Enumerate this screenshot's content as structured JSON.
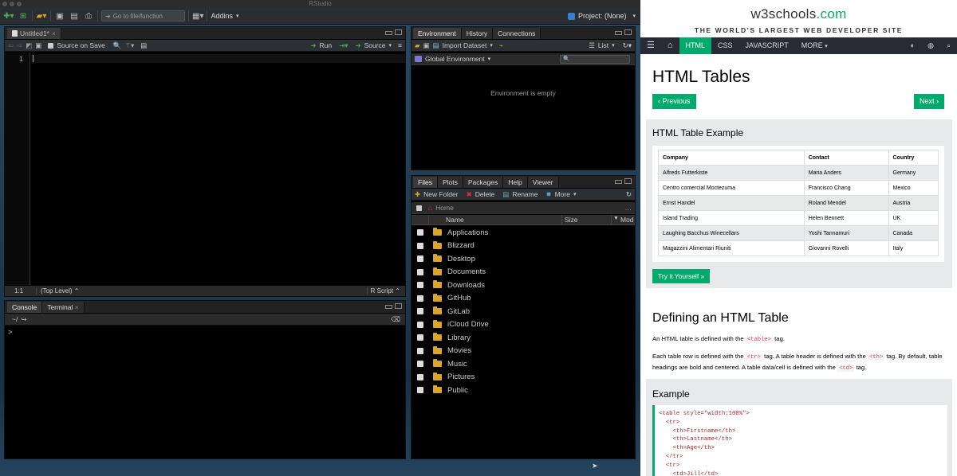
{
  "rstudio": {
    "window_title": "RStudio",
    "toolbar": {
      "goto_placeholder": "Go to file/function",
      "addins": "Addins",
      "project": "Project: (None)"
    },
    "source": {
      "tab": "Untitled1*",
      "source_on_save": "Source on Save",
      "run": "Run",
      "source_btn": "Source",
      "line_number": "1",
      "status_pos": "1:1",
      "status_scope": "(Top Level)",
      "status_type": "R Script"
    },
    "console": {
      "tabs": [
        "Console",
        "Terminal"
      ],
      "path": "~/",
      "prompt": ">"
    },
    "env": {
      "tabs": [
        "Environment",
        "History",
        "Connections"
      ],
      "import": "Import Dataset",
      "list": "List",
      "global": "Global Environment",
      "empty": "Environment is empty"
    },
    "files": {
      "tabs": [
        "Files",
        "Plots",
        "Packages",
        "Help",
        "Viewer"
      ],
      "new_folder": "New Folder",
      "delete": "Delete",
      "rename": "Rename",
      "more": "More",
      "home": "Home",
      "col_name": "Name",
      "col_size": "Size",
      "col_mod": "Mod",
      "items": [
        "Applications",
        "Blizzard",
        "Desktop",
        "Documents",
        "Downloads",
        "GitHub",
        "GitLab",
        "iCloud Drive",
        "Library",
        "Movies",
        "Music",
        "Pictures",
        "Public"
      ]
    }
  },
  "w3": {
    "logo_main": "w3schools",
    "logo_dot": ".com",
    "tagline": "THE WORLD'S LARGEST WEB DEVELOPER SITE",
    "nav": [
      "HTML",
      "CSS",
      "JAVASCRIPT",
      "MORE"
    ],
    "title": "HTML Tables",
    "prev": "‹ Previous",
    "next": "Next ›",
    "example_title": "HTML Table Example",
    "table": {
      "headers": [
        "Company",
        "Contact",
        "Country"
      ],
      "rows": [
        [
          "Alfreds Futterkiste",
          "Maria Anders",
          "Germany"
        ],
        [
          "Centro comercial Moctezuma",
          "Francisco Chang",
          "Mexico"
        ],
        [
          "Ernst Handel",
          "Roland Mendel",
          "Austria"
        ],
        [
          "Island Trading",
          "Helen Bennett",
          "UK"
        ],
        [
          "Laughing Bacchus Winecellars",
          "Yoshi Tannamuri",
          "Canada"
        ],
        [
          "Magazzini Alimentari Riuniti",
          "Giovanni Rovelli",
          "Italy"
        ]
      ]
    },
    "try_it": "Try it Yourself »",
    "define_title": "Defining an HTML Table",
    "p1_a": "An HTML table is defined with the",
    "p1_tag": "<table>",
    "p1_b": "tag.",
    "p2_a": "Each table row is defined with the",
    "p2_tag1": "<tr>",
    "p2_b": "tag. A table header is defined with the",
    "p2_tag2": "<th>",
    "p2_c": "tag. By default, table headings are bold and centered. A table data/cell is defined with the",
    "p2_tag3": "<td>",
    "p2_d": "tag.",
    "example2_title": "Example",
    "code": [
      "<table style=\"width:100%\">",
      "  <tr>",
      "    <th>Firstname</th>",
      "    <th>Lastname</th>",
      "    <th>Age</th>",
      "  </tr>",
      "  <tr>",
      "    <td>Jill</td>"
    ]
  }
}
